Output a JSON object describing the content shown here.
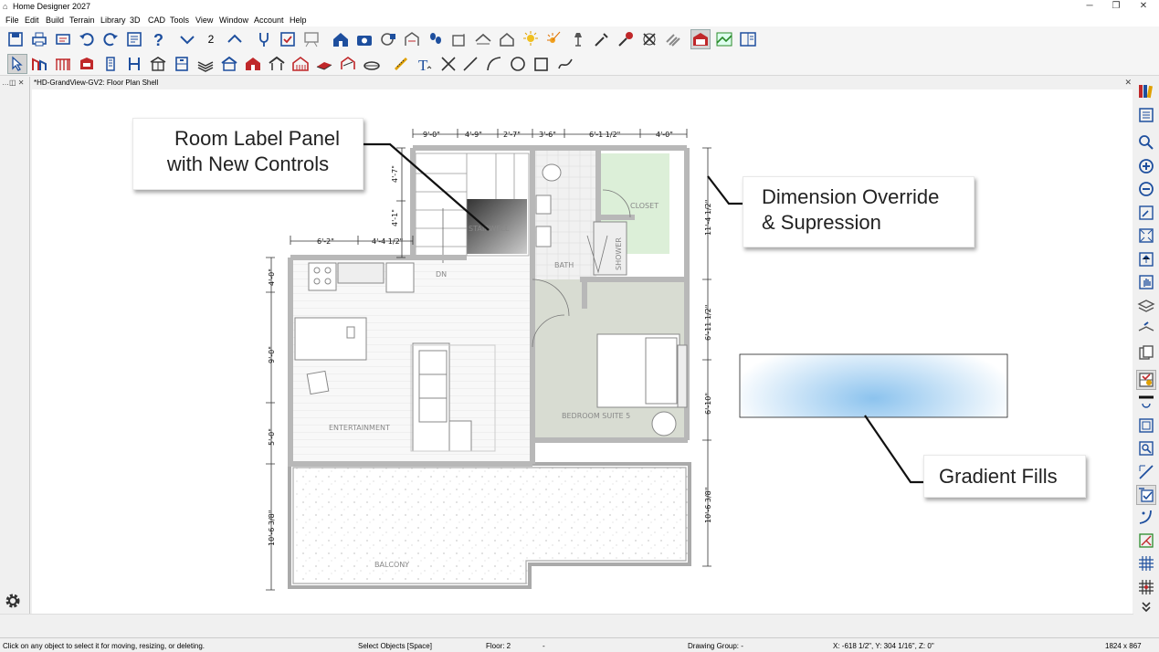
{
  "window": {
    "title": "Home Designer 2027",
    "minimize": "─",
    "maximize": "❐",
    "close": "✕"
  },
  "menu": [
    "File",
    "Edit",
    "Build",
    "Terrain",
    "Library",
    "3D",
    "CAD",
    "Tools",
    "View",
    "Window",
    "Account",
    "Help"
  ],
  "toolbar": {
    "floor_number": "2"
  },
  "tab": {
    "title": "*HD-GrandView-GV2: Floor Plan Shell",
    "close": "✕"
  },
  "left_controls": "…◫ ✕",
  "plan": {
    "rooms": {
      "stairwell": "STAIRWELL",
      "bath": "BATH",
      "closet": "CLOSET",
      "shower": "SHOWER",
      "dn": "DN",
      "entertainment": "ENTERTAINMENT",
      "bedroom": "BEDROOM SUITE 5",
      "balcony": "BALCONY"
    },
    "dimensions": {
      "top": [
        "9'-0\"",
        "4'-9\"",
        "2'-7\"",
        "3'-6\"",
        "6'-1 1/2\"",
        "4'-0\""
      ],
      "mid_top": [
        "6'-2\"",
        "4'-4 1/2\""
      ],
      "left_upper": [
        "4'-7\"",
        "4'-1\""
      ],
      "left": [
        "4'-0\"",
        "9'-0\"",
        "5'-0\"",
        "10'-6 3/8\""
      ],
      "right": [
        "11'-4 1/2\"",
        "6'-11 1/2\"",
        "6'-10\"",
        "10'-6 3/8\""
      ]
    }
  },
  "callouts": {
    "room_label_line1": "Room Label Panel",
    "room_label_line2": "with New Controls",
    "dimension_line1": "Dimension Override",
    "dimension_line2": "& Supression",
    "gradient": "Gradient Fills"
  },
  "status": {
    "hint": "Click on any object to select it for moving, resizing, or deleting.",
    "mode": "Select Objects [Space]",
    "floor": "Floor: 2",
    "dash": "-",
    "group": "Drawing Group: -",
    "coords": "X: -618 1/2\", Y: 304 1/16\", Z: 0\"",
    "size": "1824 x 867"
  },
  "colors": {
    "wall": "#b8b8b8",
    "bedroom_fill": "#d8dcd2",
    "closet_fill": "#dcefd8",
    "gradient_center": "#8cc3ee",
    "accent_blue": "#1e4f9e",
    "accent_red": "#c0282a"
  }
}
